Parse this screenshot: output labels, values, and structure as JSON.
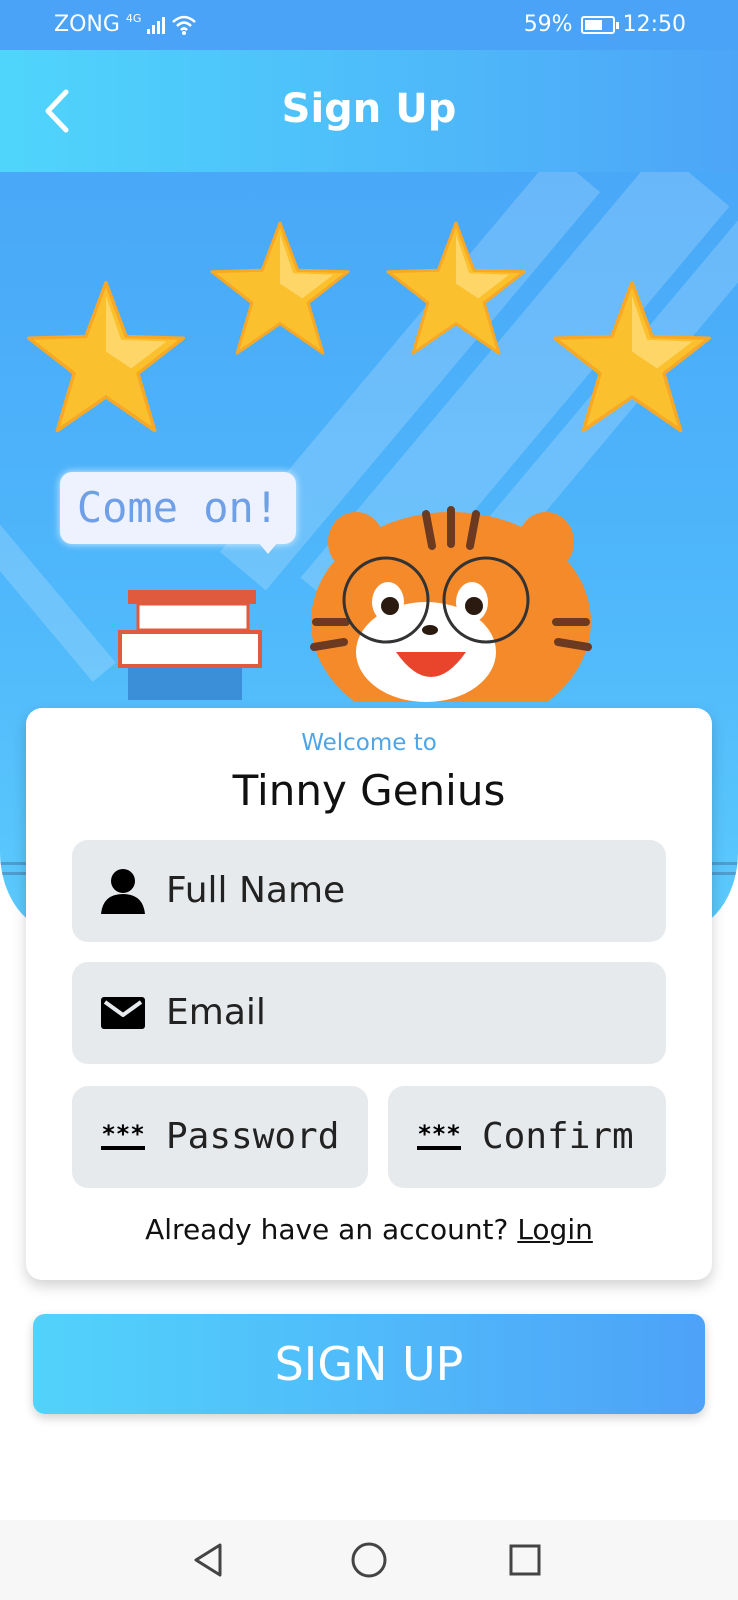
{
  "status_bar": {
    "carrier": "ZONG",
    "network": "4G",
    "battery": "59%",
    "time": "12:50"
  },
  "header": {
    "title": "Sign Up",
    "back_icon": "chevron-left-icon"
  },
  "hero": {
    "speech_bubble": "Come on!",
    "stars_count": 4
  },
  "card": {
    "welcome": "Welcome to",
    "app_name": "Tinny Genius",
    "fields": {
      "full_name": {
        "placeholder": "Full Name",
        "icon": "person-icon"
      },
      "email": {
        "placeholder": "Email",
        "icon": "mail-icon"
      },
      "password": {
        "placeholder": "Password",
        "icon": "password-icon"
      },
      "confirm": {
        "placeholder": "Confirm",
        "icon": "password-icon"
      }
    },
    "account_prompt": "Already have an account?",
    "login_link": "Login"
  },
  "signup_button": "SIGN UP",
  "colors": {
    "header_start": "#4fd5fb",
    "header_end": "#4da5f8",
    "welcome": "#4da5e8",
    "field_bg": "#e7eaec"
  },
  "nav": {
    "back": "nav-back-icon",
    "home": "nav-home-icon",
    "recents": "nav-recents-icon"
  }
}
